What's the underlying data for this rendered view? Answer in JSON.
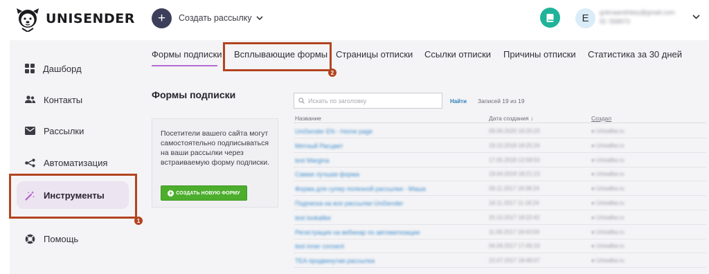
{
  "app": {
    "brand": "UNISENDER",
    "create_label": "Создать рассылку",
    "avatar_letter": "E",
    "user_email": "gnknaandnkey@gmail.com",
    "user_id": "ID: 558972"
  },
  "sidebar": {
    "items": [
      {
        "label": "Дашборд",
        "icon": "dashboard-icon"
      },
      {
        "label": "Контакты",
        "icon": "contacts-icon"
      },
      {
        "label": "Рассылки",
        "icon": "mail-icon"
      },
      {
        "label": "Автоматизация",
        "icon": "automation-icon"
      },
      {
        "label": "Инструменты",
        "icon": "magic-wand-icon",
        "active": true
      },
      {
        "label": "Помощь",
        "icon": "help-icon"
      }
    ]
  },
  "tabs": [
    {
      "label": "Формы подписки",
      "active": true
    },
    {
      "label": "Всплывающие формы"
    },
    {
      "label": "Страницы отписки"
    },
    {
      "label": "Ссылки отписки"
    },
    {
      "label": "Причины отписки"
    },
    {
      "label": "Статистика за 30 дней"
    }
  ],
  "main": {
    "title": "Формы подписки",
    "info_text": "Посетители вашего сайта могут самостоятельно подписываться на ваши рассылки через встраиваемую форму подписки.",
    "create_form_button": "СОЗДАТЬ НОВУЮ ФОРМУ",
    "search_placeholder": "Искать по заголовку",
    "find_label": "Найти",
    "records_label": "Записей 19 из 19"
  },
  "table": {
    "columns": [
      "Название",
      "Дата создания ↓",
      "Создал"
    ],
    "rows": [
      {
        "name": "UniSender EN - Home page",
        "date": "09.06.2020 18:20:23",
        "user": "Unisalba.ru"
      },
      {
        "name": "Мятный Расцвет",
        "date": "19.10.2018 18:25:24",
        "user": "Unisalba.ru"
      },
      {
        "name": "test Margina",
        "date": "17.05.2018 12:58:53",
        "user": "Unisalba.ru"
      },
      {
        "name": "Самая лучшая форма",
        "date": "19.04.2018 18:21:13",
        "user": "Unisalba.ru"
      },
      {
        "name": "Форма для супер полезной рассылки - Маша",
        "date": "09.11.2017 18:38:24",
        "user": "Unisalba.ru"
      },
      {
        "name": "Подписка на все рассылки UniSender",
        "date": "18.11.2017 11:18:24",
        "user": "Unisalba.ru"
      },
      {
        "name": "test lookalike",
        "date": "20.10.2017 18:22:42",
        "user": "Unisalba.ru"
      },
      {
        "name": "Регистрация на вебинар по автоматизации",
        "date": "11.09.2017 18:43:59",
        "user": "Unisalba.ru"
      },
      {
        "name": "test inner consent",
        "date": "06.09.2017 17:49:19",
        "user": "Unisalba.ru"
      },
      {
        "name": "TEA продвинутая рассылка",
        "date": "22.07.2017 18:48:07",
        "user": "Unisalba.ru"
      }
    ]
  },
  "annotations": {
    "badge_1": "1",
    "badge_2": "2"
  },
  "colors": {
    "highlight": "#b2441f",
    "accent": "#b46ad0",
    "green": "#4cae2c",
    "teal": "#1fb39a",
    "link": "#3d8ccc"
  }
}
